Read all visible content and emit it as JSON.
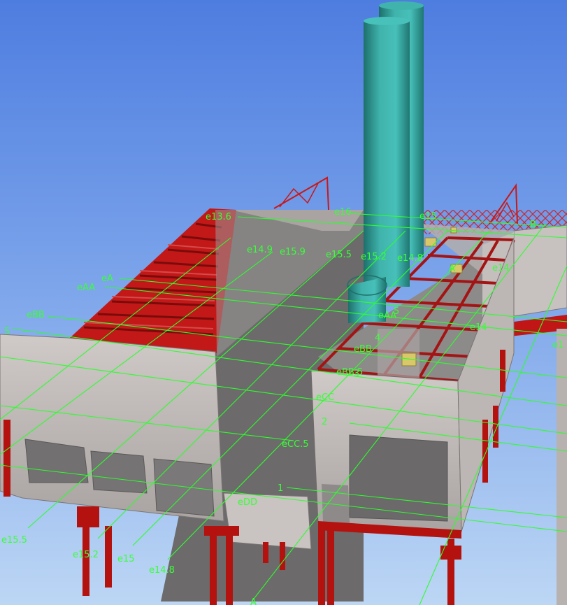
{
  "viewer": {
    "mode": "3D model view"
  },
  "colors": {
    "sky_top": "#4a78dc",
    "sky_bottom": "#b7d3f4",
    "gridline": "#29ff29",
    "steel": "#c01616",
    "steel_dark": "#7c0a0a",
    "wall": "#c9c3c1",
    "wall_shadow": "#8c8686",
    "floor": "#6e6c6c",
    "stack": "#3aa9a3",
    "equipment": "#d8c86a"
  },
  "gridlines": {
    "e13.6": "e13.6",
    "e16": "e16",
    "e15_top": "e15",
    "e14.9": "e14.9",
    "e15.9": "e15.9",
    "e15.5_top": "e15.5",
    "e15.2_top": "e15.2",
    "e14.8_top": "e14.8",
    "B_top": "B",
    "A_mid": "A",
    "e14_a": "e14",
    "e14_b": "e14",
    "eA": "eA",
    "eAA": "eAA",
    "eBB": "eBB",
    "g5_left": "5",
    "eAA_mid": "eAA",
    "g5_mid": "5",
    "g4": "4",
    "eBB_mid": "eBB",
    "eBB5": "eBB.5",
    "g3": "3",
    "eCC": "eCC",
    "g2": "2",
    "eCC5": "eCC.5",
    "g1": "1",
    "eDD": "eDD",
    "e15.5_bottom": "e15.5",
    "e15.2_bottom": "e15.2",
    "e15_bottom": "e15",
    "e14.8_bottom": "e14.8",
    "A_bottom": "A",
    "e13_right": "e1"
  },
  "model_elements": {
    "stacks": [
      "stack-front",
      "stack-rear"
    ],
    "structures": [
      "left-roof-truss",
      "left-building",
      "right-building",
      "rear-canopy-truss",
      "right-annex"
    ],
    "equipment_count": 4
  }
}
